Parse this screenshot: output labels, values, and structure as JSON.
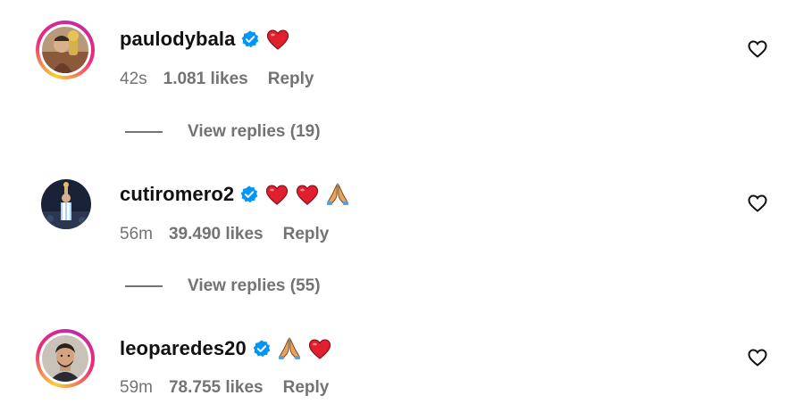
{
  "comments": [
    {
      "username": "paulodybala",
      "verified": true,
      "emojis": [
        "red-heart-icon"
      ],
      "time": "42s",
      "likes": "1.081 likes",
      "reply_label": "Reply",
      "view_replies": "View replies (19)"
    },
    {
      "username": "cutiromero2",
      "verified": true,
      "emojis": [
        "red-heart-icon",
        "red-heart-icon",
        "folded-hands-icon"
      ],
      "time": "56m",
      "likes": "39.490 likes",
      "reply_label": "Reply",
      "view_replies": "View replies (55)"
    },
    {
      "username": "leoparedes20",
      "verified": true,
      "emojis": [
        "folded-hands-icon",
        "red-heart-icon"
      ],
      "time": "59m",
      "likes": "78.755 likes",
      "reply_label": "Reply"
    }
  ],
  "colors": {
    "verified_blue": "#0095f6",
    "muted_text": "#737373",
    "heart_red": "#e0202f"
  }
}
